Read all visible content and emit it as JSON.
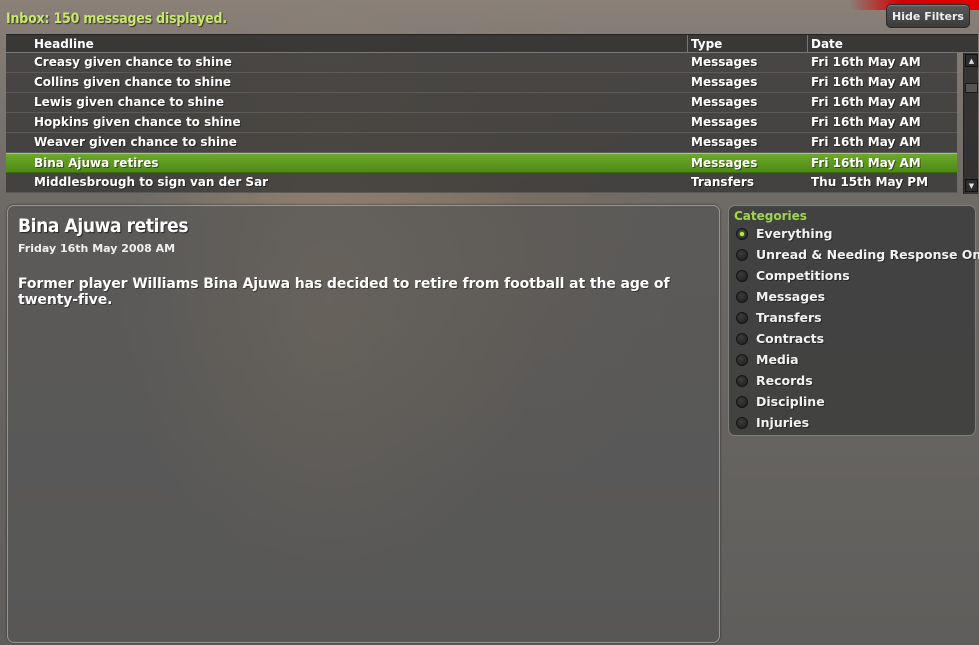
{
  "inbox": {
    "title": "Inbox: 150 messages displayed."
  },
  "toolbar": {
    "hide_filters_label": "Hide Filters"
  },
  "table": {
    "columns": [
      "Headline",
      "Type",
      "Date"
    ],
    "rows": [
      {
        "headline": "Creasy given chance to shine",
        "type": "Messages",
        "date": "Fri 16th May AM",
        "selected": false
      },
      {
        "headline": "Collins given chance to shine",
        "type": "Messages",
        "date": "Fri 16th May AM",
        "selected": false
      },
      {
        "headline": "Lewis given chance to shine",
        "type": "Messages",
        "date": "Fri 16th May AM",
        "selected": false
      },
      {
        "headline": "Hopkins given chance to shine",
        "type": "Messages",
        "date": "Fri 16th May AM",
        "selected": false
      },
      {
        "headline": "Weaver given chance to shine",
        "type": "Messages",
        "date": "Fri 16th May AM",
        "selected": false
      },
      {
        "headline": "Bina Ajuwa retires",
        "type": "Messages",
        "date": "Fri 16th May AM",
        "selected": true
      },
      {
        "headline": "Middlesbrough to sign van der Sar",
        "type": "Transfers",
        "date": "Thu 15th May PM",
        "selected": false
      }
    ]
  },
  "message": {
    "title": "Bina Ajuwa retires",
    "date": "Friday 16th May 2008 AM",
    "body": "Former player Williams Bina Ajuwa has decided to retire from football at the age of twenty-five."
  },
  "categories": {
    "title": "Categories",
    "items": [
      {
        "label": "Everything",
        "selected": true
      },
      {
        "label": "Unread & Needing Response Only",
        "selected": false
      },
      {
        "label": "Competitions",
        "selected": false
      },
      {
        "label": "Messages",
        "selected": false
      },
      {
        "label": "Transfers",
        "selected": false
      },
      {
        "label": "Contracts",
        "selected": false
      },
      {
        "label": "Media",
        "selected": false
      },
      {
        "label": "Records",
        "selected": false
      },
      {
        "label": "Discipline",
        "selected": false
      },
      {
        "label": "Injuries",
        "selected": false
      }
    ]
  },
  "icons": {
    "scroll_up": "arrow-up-icon",
    "scroll_down": "arrow-down-icon",
    "radio": "radio-icon"
  },
  "colors": {
    "accent_green": "#9fd64a",
    "title_green": "#c8e86a",
    "selected_row": "#5a9a1e",
    "brand_red": "#d40000"
  }
}
